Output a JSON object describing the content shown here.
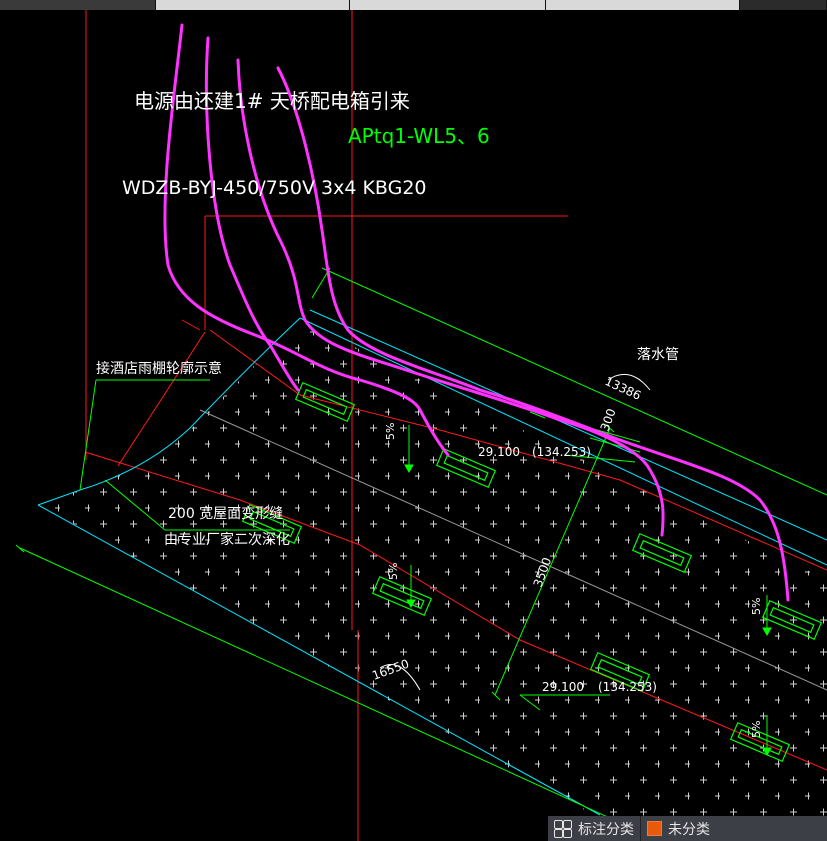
{
  "tabs": [
    "",
    "",
    "",
    ""
  ],
  "annotations": {
    "power_source": "电源由还建1# 天桥配电箱引来",
    "circuit_id": "APtq1-WL5、6",
    "cable_spec": "WDZB-BYJ-450/750V 3x4  KBG20",
    "canopy_note": "接酒店雨棚轮廓示意",
    "joint_note_1": "200  宽屋面变形缝",
    "joint_note_2": "由专业厂家二次深化",
    "downpipe": "落水管",
    "dim_13386": "13386",
    "dim_16550": "16550",
    "dim_300": "300",
    "dim_3500": "3500",
    "elev_1": "29.100",
    "elev_1b": "(134.253)",
    "elev_2": "29.100",
    "elev_2b": "(134.253)",
    "slope": "5%"
  },
  "colors": {
    "background": "#000000",
    "green": "#00ff00",
    "cyan": "#00e5ff",
    "red": "#ff1a1a",
    "magenta": "#ff33ff",
    "white": "#ffffff",
    "gray": "#9a9a9a"
  },
  "status_bar": {
    "category_label": "标注分类",
    "unclassified_label": "未分类",
    "icon": "grid-icon"
  }
}
